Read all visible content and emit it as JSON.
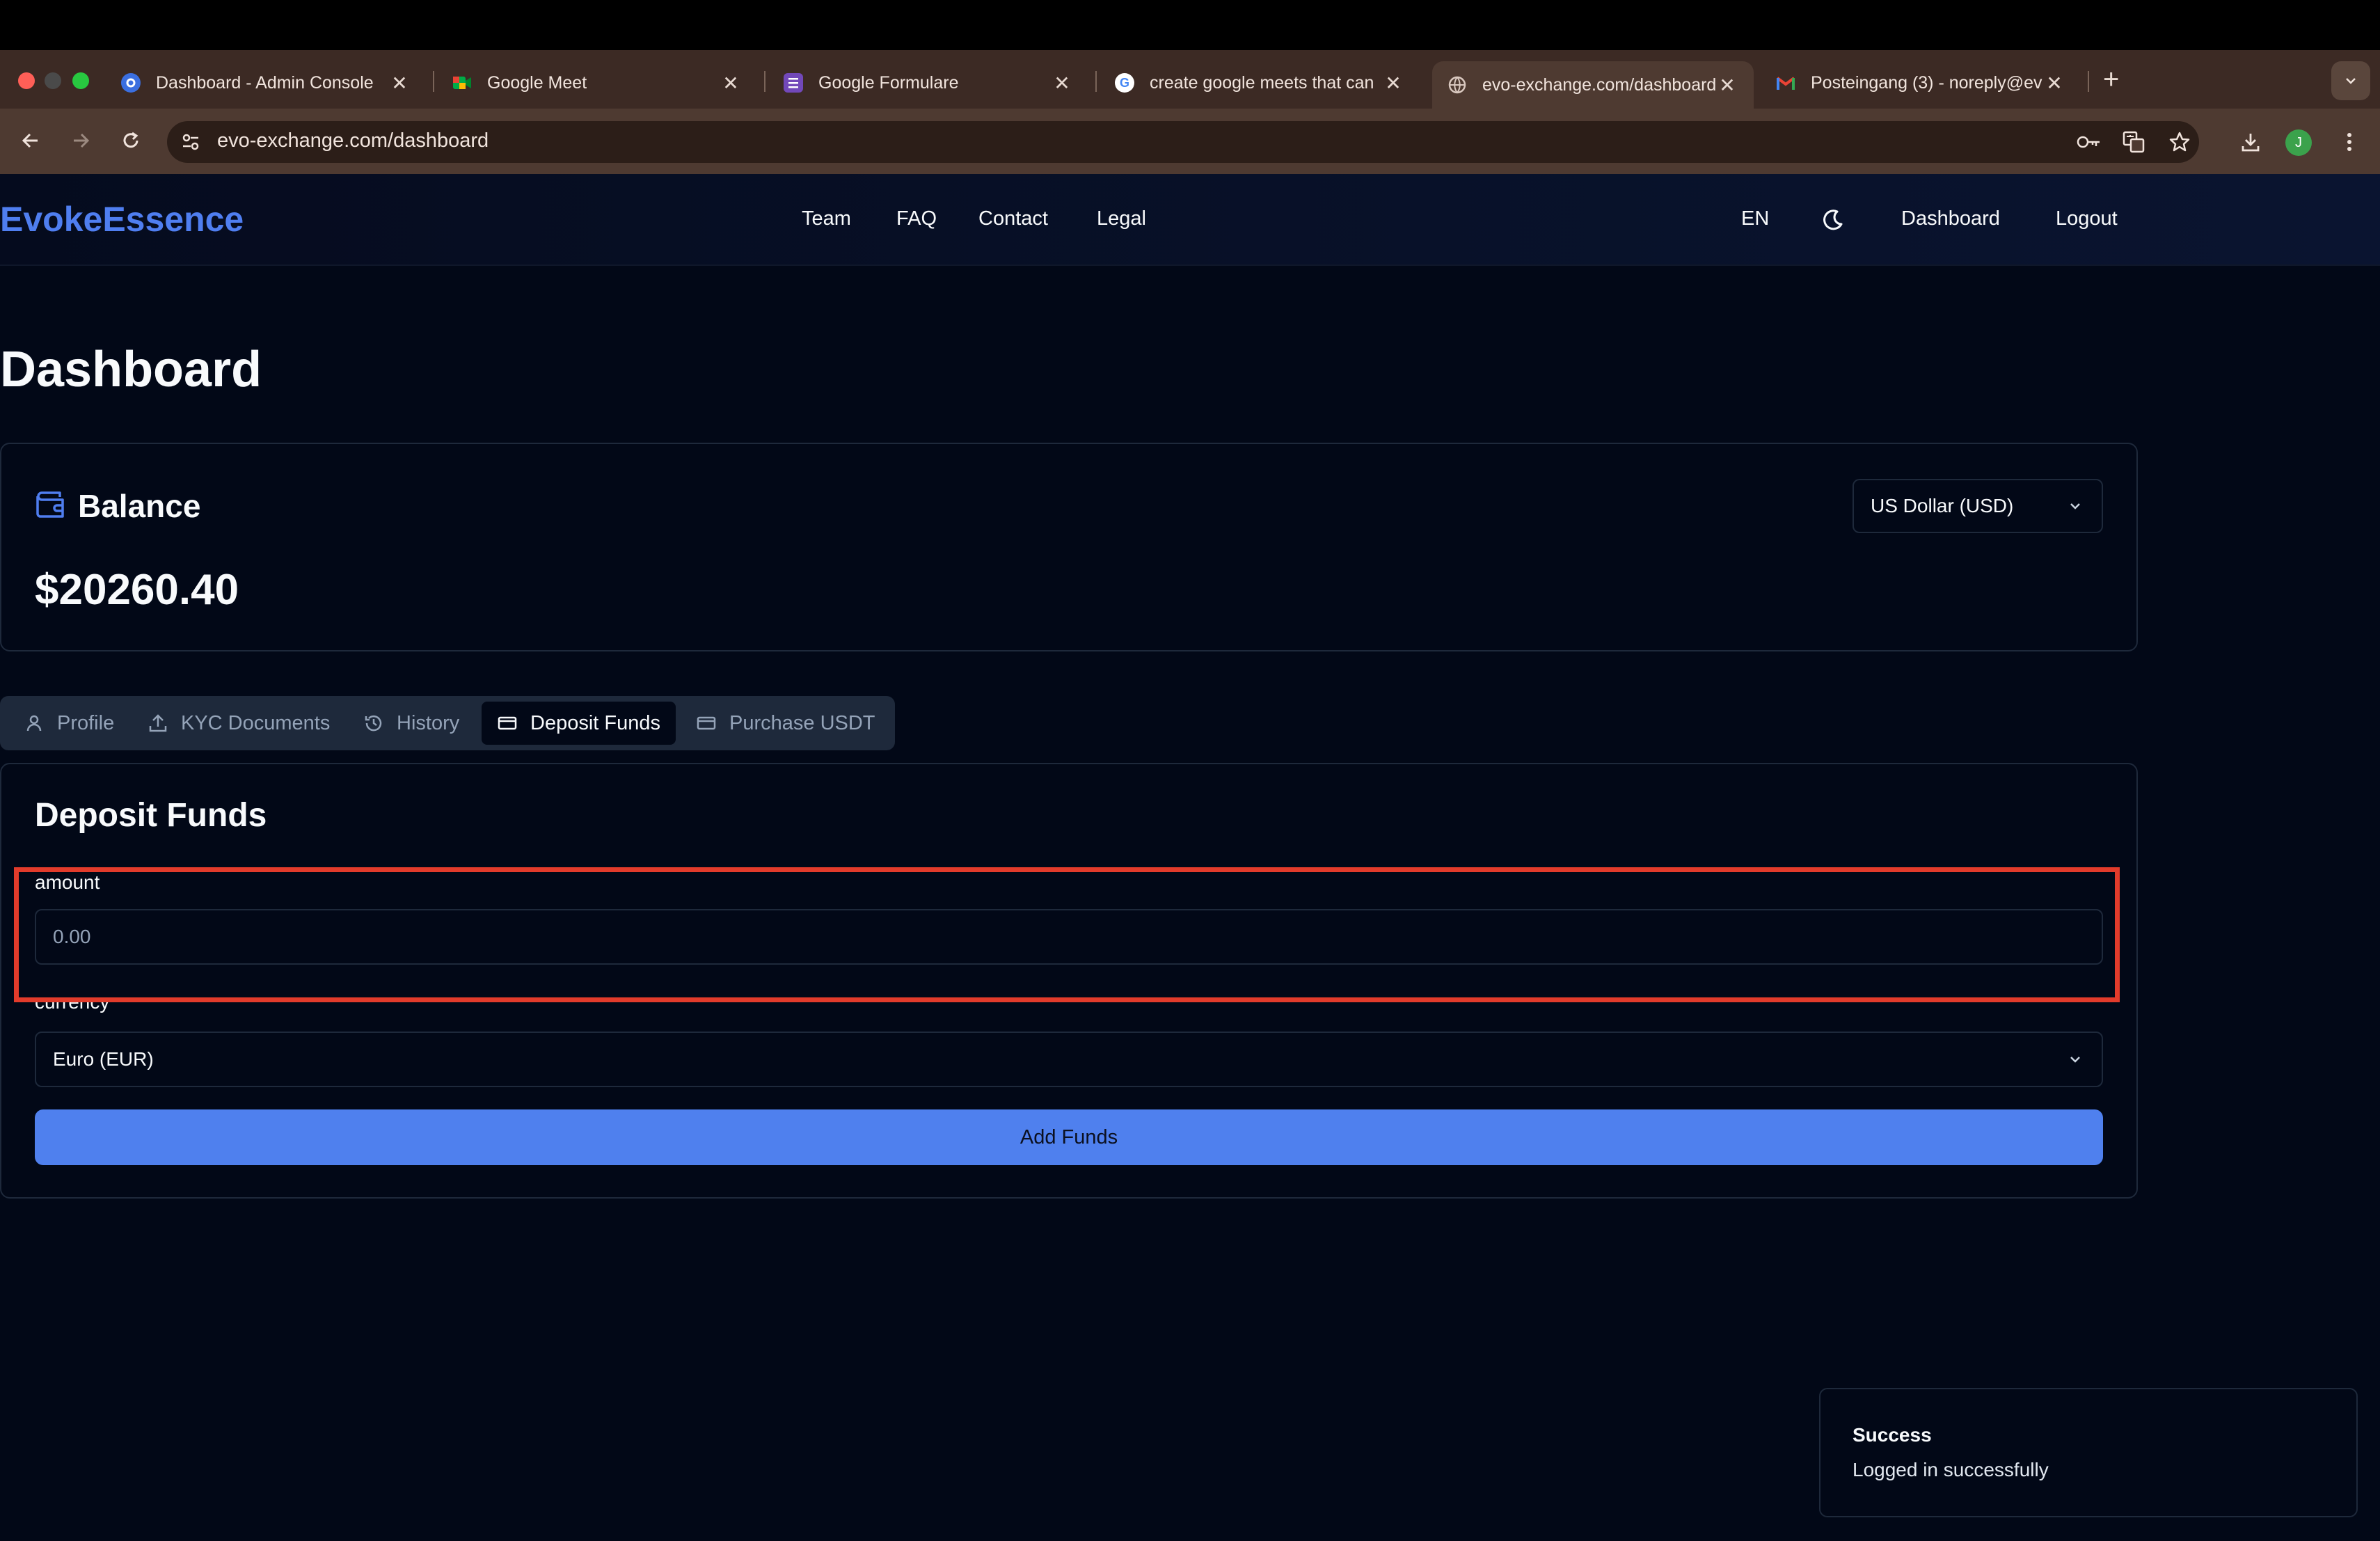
{
  "browser": {
    "tabs": [
      {
        "label": "Dashboard - Admin Console",
        "icon": "admin-console-favicon",
        "active": false
      },
      {
        "label": "Google Meet",
        "icon": "google-meet-favicon",
        "active": false
      },
      {
        "label": "Google Formulare",
        "icon": "google-forms-favicon",
        "active": false
      },
      {
        "label": "create google meets that can",
        "icon": "google-favicon",
        "active": false
      },
      {
        "label": "evo-exchange.com/dashboard",
        "icon": "globe-favicon",
        "active": true
      },
      {
        "label": "Posteingang (3) - noreply@ev",
        "icon": "gmail-favicon",
        "active": false
      }
    ],
    "close_glyph": "✕",
    "new_tab_glyph": "+",
    "url": "evo-exchange.com/dashboard",
    "profile_initial": "J"
  },
  "header": {
    "brand": "EvokeEssence",
    "nav": [
      "Team",
      "FAQ",
      "Contact",
      "Legal"
    ],
    "language": "EN",
    "dashboard_link": "Dashboard",
    "logout_link": "Logout"
  },
  "page": {
    "title": "Dashboard"
  },
  "balance": {
    "title": "Balance",
    "amount": "$20260.40",
    "currency_selected": "US Dollar (USD)"
  },
  "tabs": [
    {
      "label": "Profile",
      "icon": "user-icon",
      "active": false
    },
    {
      "label": "KYC Documents",
      "icon": "upload-icon",
      "active": false
    },
    {
      "label": "History",
      "icon": "history-icon",
      "active": false
    },
    {
      "label": "Deposit Funds",
      "icon": "credit-card-icon",
      "active": true
    },
    {
      "label": "Purchase USDT",
      "icon": "credit-card-icon",
      "active": false
    }
  ],
  "deposit": {
    "title": "Deposit Funds",
    "amount_label": "amount",
    "amount_placeholder": "0.00",
    "amount_value": "",
    "currency_label": "currency",
    "currency_selected": "Euro (EUR)",
    "submit_label": "Add Funds"
  },
  "toast": {
    "title": "Success",
    "description": "Logged in successfully"
  },
  "colors": {
    "background": "#020817",
    "brand": "#4f7ef0",
    "primary_button": "#4f80ee",
    "highlight": "#e23b2b",
    "tabstrip": "#3c2a24"
  }
}
